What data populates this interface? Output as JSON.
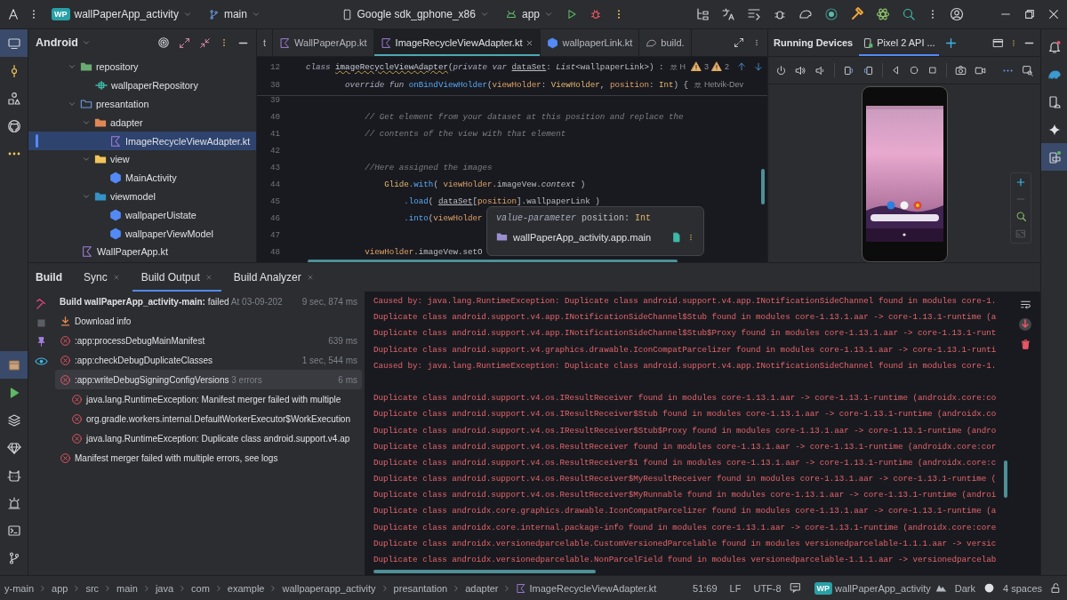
{
  "top_bar": {
    "project_badge": "WP",
    "project": "wallPaperApp_activity",
    "branch": "main",
    "device": "Google sdk_gphone_x86",
    "run_config": "app"
  },
  "left_toolbar": {
    "top": [
      {
        "kind": "project",
        "selected": true
      },
      {
        "kind": "commit",
        "selected": false
      },
      {
        "kind": "structure",
        "selected": false
      },
      {
        "kind": "github",
        "selected": false
      },
      {
        "kind": "more",
        "selected": false
      }
    ],
    "bottom": [
      {
        "kind": "build",
        "selected": true
      },
      {
        "kind": "run",
        "selected": false
      },
      {
        "kind": "layers",
        "selected": false
      },
      {
        "kind": "gem",
        "selected": false
      },
      {
        "kind": "logcat",
        "selected": false
      },
      {
        "kind": "inspection",
        "selected": false
      },
      {
        "kind": "terminal",
        "selected": false
      },
      {
        "kind": "git",
        "selected": false
      }
    ]
  },
  "project_panel": {
    "view": "Android",
    "tree": [
      {
        "label": "repository",
        "kind": "folder",
        "color": "#6aab73",
        "expanded": true,
        "selected": false,
        "children": [
          {
            "label": "wallpaperRepository",
            "kind": "interface",
            "selected": false
          }
        ]
      },
      {
        "label": "presantation",
        "kind": "package",
        "expanded": true,
        "selected": false,
        "children": [
          {
            "label": "adapter",
            "kind": "folder",
            "color": "#e08855",
            "expanded": true,
            "selected": false,
            "children": [
              {
                "label": "ImageRecycleViewAdapter.kt",
                "kind": "kotlin",
                "selected": true
              }
            ]
          },
          {
            "label": "view",
            "kind": "folder",
            "color": "#f2c55c",
            "expanded": true,
            "selected": false,
            "children": [
              {
                "label": "MainActivity",
                "kind": "class",
                "selected": false
              }
            ]
          },
          {
            "label": "viewmodel",
            "kind": "folder",
            "color": "#3592c4",
            "expanded": true,
            "selected": false,
            "children": [
              {
                "label": "wallpaperUistate",
                "kind": "class",
                "selected": false
              },
              {
                "label": "wallpaperViewModel",
                "kind": "class",
                "selected": false
              }
            ]
          }
        ]
      },
      {
        "label": "WallPaperApp.kt",
        "kind": "kotlin",
        "selected": false
      }
    ]
  },
  "editor": {
    "tabs": [
      {
        "label": "t",
        "kind": "none",
        "selected": false
      },
      {
        "label": "WallPaperApp.kt",
        "kind": "kotlin",
        "selected": false
      },
      {
        "label": "ImageRecycleViewAdapter.kt",
        "kind": "kotlin",
        "selected": true
      },
      {
        "label": "wallpaperLink.kt",
        "kind": "class",
        "selected": false
      },
      {
        "label": "build.",
        "kind": "gradle",
        "selected": false
      }
    ],
    "sticky_lines": [
      {
        "number": "12",
        "tokens": [
          {
            "text": "class ",
            "kind": "kw"
          },
          {
            "text": "imageRecycleViewAdapter",
            "kind": "warning"
          },
          {
            "text": "(",
            "kind": "plain"
          },
          {
            "text": "private var ",
            "kind": "kw"
          },
          {
            "text": "dataSet",
            "kind": "ref"
          },
          {
            "text": ": ",
            "kind": "plain"
          },
          {
            "text": "List",
            "kind": "italic"
          },
          {
            "text": "<wallpaperLink>) :",
            "kind": "plain"
          }
        ],
        "author": "H",
        "warnings": [
          "3",
          "2"
        ]
      },
      {
        "number": "38",
        "tokens": [
          {
            "text": "        override fun ",
            "kind": "kw"
          },
          {
            "text": "onBindViewHolder",
            "kind": "fn"
          },
          {
            "text": "(",
            "kind": "plain"
          },
          {
            "text": "viewHolder",
            "kind": "param"
          },
          {
            "text": ": ",
            "kind": "plain"
          },
          {
            "text": "ViewHolder",
            "kind": "type"
          },
          {
            "text": ", ",
            "kind": "plain"
          },
          {
            "text": "position",
            "kind": "param"
          },
          {
            "text": ": ",
            "kind": "plain"
          },
          {
            "text": "Int",
            "kind": "type"
          },
          {
            "text": ") {",
            "kind": "plain"
          }
        ],
        "author": "Hetvik-Dev"
      }
    ],
    "lines": [
      {
        "number": "39"
      },
      {
        "number": "40",
        "tokens": [
          {
            "text": "            // Get element from your dataset at this position and replace the",
            "kind": "comment"
          }
        ]
      },
      {
        "number": "41",
        "tokens": [
          {
            "text": "            // contents of the view with that element",
            "kind": "comment"
          }
        ]
      },
      {
        "number": "42"
      },
      {
        "number": "43",
        "tokens": [
          {
            "text": "            //Here assigned the images",
            "kind": "comment"
          }
        ]
      },
      {
        "number": "44",
        "tokens": [
          {
            "text": "                Glide",
            "kind": "type"
          },
          {
            "text": ".with",
            "kind": "fn"
          },
          {
            "text": "( ",
            "kind": "plain"
          },
          {
            "text": "viewHolder",
            "kind": "param"
          },
          {
            "text": ".imageVew.",
            "kind": "plain"
          },
          {
            "text": "context",
            "kind": "italic"
          },
          {
            "text": " )",
            "kind": "plain"
          }
        ]
      },
      {
        "number": "45",
        "tokens": [
          {
            "text": "                    .load",
            "kind": "fn"
          },
          {
            "text": "( ",
            "kind": "plain"
          },
          {
            "text": "dataSet",
            "kind": "ref"
          },
          {
            "text": "[",
            "kind": "plain"
          },
          {
            "text": "position",
            "kind": "param"
          },
          {
            "text": "].wallpaperLink )",
            "kind": "plain"
          }
        ]
      },
      {
        "number": "46",
        "tokens": [
          {
            "text": "                    .into",
            "kind": "fn"
          },
          {
            "text": "(",
            "kind": "plain"
          },
          {
            "text": "viewHolder",
            "kind": "param"
          }
        ]
      },
      {
        "number": "47"
      },
      {
        "number": "48",
        "tokens": [
          {
            "text": "            viewHolder",
            "kind": "param"
          },
          {
            "text": ".imageVew.setO",
            "kind": "plain"
          }
        ]
      }
    ],
    "tooltip": {
      "signature": [
        {
          "text": "value-parameter",
          "kind": "kw"
        },
        {
          "text": " position: ",
          "kind": "plain"
        },
        {
          "text": "Int",
          "kind": "type"
        }
      ],
      "location": "wallPaperApp_activity.app.main"
    }
  },
  "running_devices": {
    "title": "Running Devices",
    "tabs": [
      {
        "label": "Pixel 2 API ...",
        "selected": true
      }
    ]
  },
  "right_toolbar": [
    {
      "kind": "notifications",
      "selected": false
    },
    {
      "kind": "gradle",
      "selected": false
    },
    {
      "kind": "device-manager",
      "selected": false
    },
    {
      "kind": "assistant",
      "selected": false
    },
    {
      "kind": "running-devices",
      "selected": true
    }
  ],
  "build": {
    "title": "Build",
    "tabs": [
      {
        "label": "Sync",
        "selected": false
      },
      {
        "label": "Build Output",
        "selected": true
      },
      {
        "label": "Build Analyzer",
        "selected": false
      }
    ],
    "summary": {
      "title": "Build wallPaperApp_activity-main:",
      "status": "failed",
      "date": "At 03-09-202",
      "duration": "9 sec, 874 ms"
    },
    "items": [
      {
        "kind": "download",
        "label": "Download info",
        "selected": false
      },
      {
        "kind": "error",
        "label": ":app:processDebugMainManifest",
        "duration": "639 ms",
        "selected": false
      },
      {
        "kind": "error",
        "label": ":app:checkDebugDuplicateClasses",
        "duration": "1 sec, 544 ms",
        "selected": false
      },
      {
        "kind": "error",
        "label": ":app:writeDebugSigningConfigVersions",
        "note": "3 errors",
        "duration": "6 ms",
        "selected": true,
        "children": [
          {
            "kind": "error",
            "label": "java.lang.RuntimeException: Manifest merger failed with multiple",
            "selected": false
          },
          {
            "kind": "error",
            "label": "org.gradle.workers.internal.DefaultWorkerExecutor$WorkExecution",
            "selected": false
          },
          {
            "kind": "error",
            "label": "java.lang.RuntimeException: Duplicate class android.support.v4.ap",
            "selected": false
          }
        ]
      },
      {
        "kind": "error",
        "label": "Manifest merger failed with multiple errors, see logs",
        "selected": false
      }
    ],
    "log_blocks": [
      [
        "Caused by: java.lang.RuntimeException: Duplicate class android.support.v4.app.INotificationSideChannel found in modules core-1.",
        "Duplicate class android.support.v4.app.INotificationSideChannel$Stub found in modules core-1.13.1.aar -> core-1.13.1-runtime (a",
        "Duplicate class android.support.v4.app.INotificationSideChannel$Stub$Proxy found in modules core-1.13.1.aar -> core-1.13.1-runt",
        "Duplicate class android.support.v4.graphics.drawable.IconCompatParcelizer found in modules core-1.13.1.aar -> core-1.13.1-runti",
        "Caused by: java.lang.RuntimeException: Duplicate class android.support.v4.app.INotificationSideChannel found in modules core-1."
      ],
      [
        "Duplicate class android.support.v4.os.IResultReceiver found in modules core-1.13.1.aar -> core-1.13.1-runtime (androidx.core:co",
        "Duplicate class android.support.v4.os.IResultReceiver$Stub found in modules core-1.13.1.aar -> core-1.13.1-runtime (androidx.co",
        "Duplicate class android.support.v4.os.IResultReceiver$Stub$Proxy found in modules core-1.13.1.aar -> core-1.13.1-runtime (andro",
        "Duplicate class android.support.v4.os.ResultReceiver found in modules core-1.13.1.aar -> core-1.13.1-runtime (androidx.core:cor",
        "Duplicate class android.support.v4.os.ResultReceiver$1 found in modules core-1.13.1.aar -> core-1.13.1-runtime (androidx.core:c",
        "Duplicate class android.support.v4.os.ResultReceiver$MyResultReceiver found in modules core-1.13.1.aar -> core-1.13.1-runtime (",
        "Duplicate class android.support.v4.os.ResultReceiver$MyRunnable found in modules core-1.13.1.aar -> core-1.13.1-runtime (androi",
        "Duplicate class androidx.core.graphics.drawable.IconCompatParcelizer found in modules core-1.13.1.aar -> core-1.13.1-runtime (a",
        "Duplicate class androidx.core.internal.package-info found in modules core-1.13.1.aar -> core-1.13.1-runtime (androidx.core:core",
        "Duplicate class androidx.versionedparcelable.CustomVersionedParcelable found in modules versionedparcelable-1.1.1.aar -> versic",
        "Duplicate class androidx.versionedparcelable.NonParcelField found in modules versionedparcelable-1.1.1.aar -> versionedparcelab"
      ]
    ]
  },
  "status_bar": {
    "breadcrumbs": [
      "y-main",
      "app",
      "src",
      "main",
      "java",
      "com",
      "example",
      "wallpaperapp_activity",
      "presantation",
      "adapter",
      "ImageRecycleViewAdapter.kt"
    ],
    "position": "51:69",
    "line_separator": "LF",
    "encoding": "UTF-8",
    "project_badge": "WP",
    "project": "wallPaperApp_activity",
    "theme": "Dark",
    "indent": "4 spaces"
  }
}
